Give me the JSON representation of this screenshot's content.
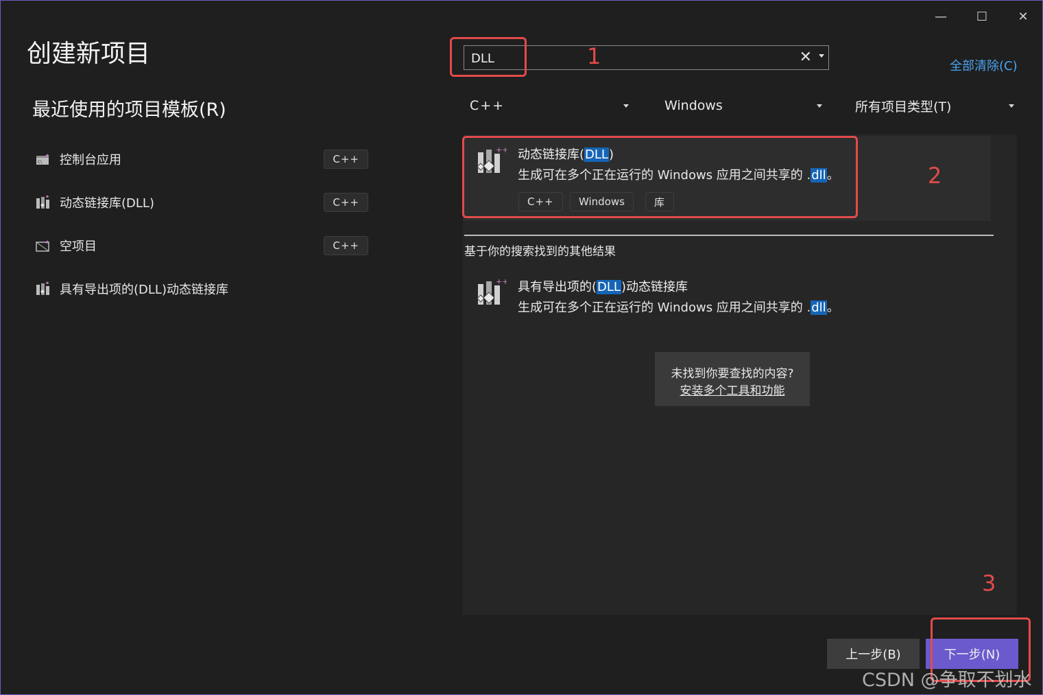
{
  "window": {
    "minimize": "—",
    "maximize": "☐",
    "close": "✕"
  },
  "title": "创建新项目",
  "recent": {
    "heading": "最近使用的项目模板(R)",
    "items": [
      {
        "label": "控制台应用",
        "tag": "C++",
        "icon": "console-app-icon"
      },
      {
        "label": "动态链接库(DLL)",
        "tag": "C++",
        "icon": "dll-library-icon"
      },
      {
        "label": "空项目",
        "tag": "C++",
        "icon": "empty-project-icon"
      },
      {
        "label": "具有导出项的(DLL)动态链接库",
        "tag": "",
        "icon": "dll-library-icon"
      }
    ]
  },
  "search": {
    "value": "DLL",
    "clear_glyph": "✕",
    "clear_all": "全部清除(C)"
  },
  "filters": {
    "language": "C++",
    "platform": "Windows",
    "project_type": "所有项目类型(T)"
  },
  "results": {
    "selected": {
      "title_prefix": "动态链接库(",
      "title_highlight": "DLL",
      "title_suffix": ")",
      "desc_prefix": "生成可在多个正在运行的 Windows 应用之间共享的 .",
      "desc_highlight": "dll",
      "desc_suffix": "。",
      "tags": [
        "C++",
        "Windows",
        "库"
      ]
    },
    "other_heading": "基于你的搜索找到的其他结果",
    "other": {
      "title_prefix": "具有导出项的(",
      "title_highlight": "DLL",
      "title_suffix": ")动态链接库",
      "desc_prefix": "生成可在多个正在运行的 Windows 应用之间共享的 .",
      "desc_highlight": "dll",
      "desc_suffix": "。"
    },
    "not_found": {
      "line1": "未找到你要查找的内容?",
      "link": "安装多个工具和功能"
    }
  },
  "buttons": {
    "back": "上一步(B)",
    "next": "下一步(N)"
  },
  "annotations": [
    "1",
    "2",
    "3"
  ],
  "watermark": "CSDN @争取不划水",
  "colors": {
    "accent": "#6a5acd",
    "annotation": "#e24b4b",
    "highlight": "#1565b7",
    "link": "#4aa3f0"
  }
}
